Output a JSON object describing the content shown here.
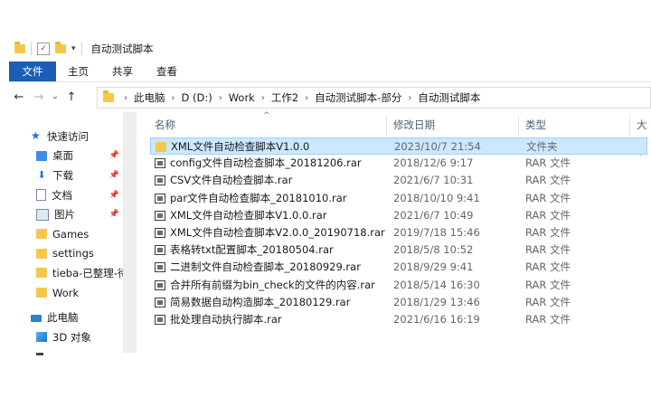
{
  "window": {
    "title": "自动测试脚本"
  },
  "ribbon": {
    "tabs": [
      "文件",
      "主页",
      "共享",
      "查看"
    ]
  },
  "address": {
    "crumbs": [
      "此电脑",
      "D (D:)",
      "Work",
      "工作2",
      "自动测试脚本-部分",
      "自动测试脚本"
    ]
  },
  "sidebar": {
    "items": [
      {
        "label": "快速访问",
        "icon": "star-icon"
      },
      {
        "label": "桌面",
        "icon": "desktop-icon",
        "pinned": true
      },
      {
        "label": "下载",
        "icon": "download-icon",
        "pinned": true
      },
      {
        "label": "文档",
        "icon": "document-icon",
        "pinned": true
      },
      {
        "label": "图片",
        "icon": "picture-icon",
        "pinned": true
      },
      {
        "label": "Games",
        "icon": "folder-icon"
      },
      {
        "label": "settings",
        "icon": "folder-icon"
      },
      {
        "label": "tieba-已整理-待",
        "icon": "folder-icon"
      },
      {
        "label": "Work",
        "icon": "folder-icon"
      },
      {
        "label": "此电脑",
        "icon": "computer-icon"
      },
      {
        "label": "3D 对象",
        "icon": "3d-objects-icon"
      }
    ]
  },
  "columns": {
    "name": "名称",
    "date": "修改日期",
    "type": "类型",
    "size": "大小"
  },
  "files": [
    {
      "name": "XML文件自动检查脚本V1.0.0",
      "date": "2023/10/7 21:54",
      "type": "文件夹",
      "kind": "folder",
      "selected": true
    },
    {
      "name": "config文件自动检查脚本_20181206.rar",
      "date": "2018/12/6 9:17",
      "type": "RAR 文件",
      "kind": "rar"
    },
    {
      "name": "CSV文件自动检查脚本.rar",
      "date": "2021/6/7 10:31",
      "type": "RAR 文件",
      "kind": "rar"
    },
    {
      "name": "par文件自动检查脚本_20181010.rar",
      "date": "2018/10/10 9:41",
      "type": "RAR 文件",
      "kind": "rar"
    },
    {
      "name": "XML文件自动检查脚本V1.0.0.rar",
      "date": "2021/6/7 10:49",
      "type": "RAR 文件",
      "kind": "rar"
    },
    {
      "name": "XML文件自动检查脚本V2.0.0_20190718.rar",
      "date": "2019/7/18 15:46",
      "type": "RAR 文件",
      "kind": "rar"
    },
    {
      "name": "表格转txt配置脚本_20180504.rar",
      "date": "2018/5/8 10:52",
      "type": "RAR 文件",
      "kind": "rar"
    },
    {
      "name": "二进制文件自动检查脚本_20180929.rar",
      "date": "2018/9/29 9:41",
      "type": "RAR 文件",
      "kind": "rar"
    },
    {
      "name": "合并所有前缀为bin_check的文件的内容.rar",
      "date": "2018/5/14 16:30",
      "type": "RAR 文件",
      "kind": "rar"
    },
    {
      "name": "简易数据自动构造脚本_20180129.rar",
      "date": "2018/1/29 13:46",
      "type": "RAR 文件",
      "kind": "rar"
    },
    {
      "name": "批处理自动执行脚本.rar",
      "date": "2021/6/16 16:19",
      "type": "RAR 文件",
      "kind": "rar"
    }
  ],
  "colors": {
    "accent": "#1a5fb4",
    "selection": "#cce8ff",
    "folder": "#f2c94c"
  }
}
